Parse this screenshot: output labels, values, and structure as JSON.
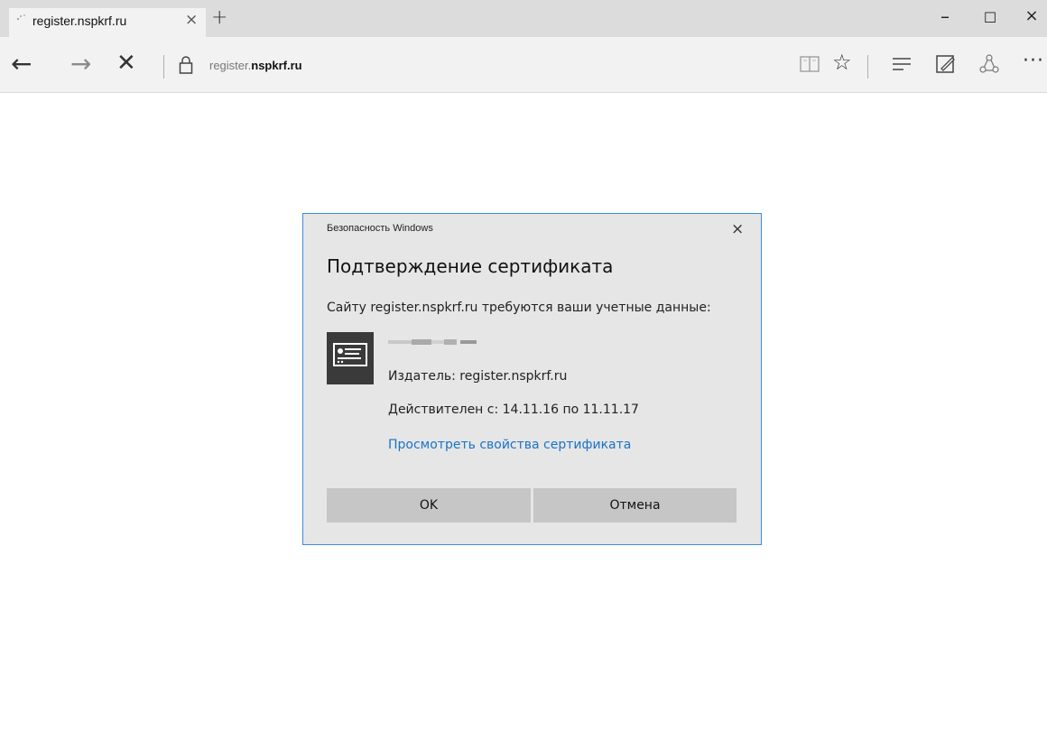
{
  "browser": {
    "tab": {
      "title": "register.nspkrf.ru",
      "close_glyph": "×"
    },
    "new_tab_glyph": "+",
    "window_controls": {
      "minimize": "–",
      "maximize": "☐",
      "close": "×"
    },
    "nav": {
      "back": "←",
      "forward": "→",
      "stop": "✕"
    },
    "address": {
      "host_prefix": "register.",
      "host_domain": "nspkrf.ru"
    },
    "toolbar": {
      "favorite": "☆",
      "more": "···"
    }
  },
  "dialog": {
    "caption": "Безопасность Windows",
    "close_glyph": "×",
    "title": "Подтверждение сертификата",
    "prompt": "Сайту register.nspkrf.ru требуются ваши учетные данные:",
    "issuer": "Издатель: register.nspkrf.ru",
    "validity": "Действителен с: 14.11.16 по 11.11.17",
    "view_link": "Просмотреть свойства сертификата",
    "ok_label": "OK",
    "cancel_label": "Отмена"
  }
}
